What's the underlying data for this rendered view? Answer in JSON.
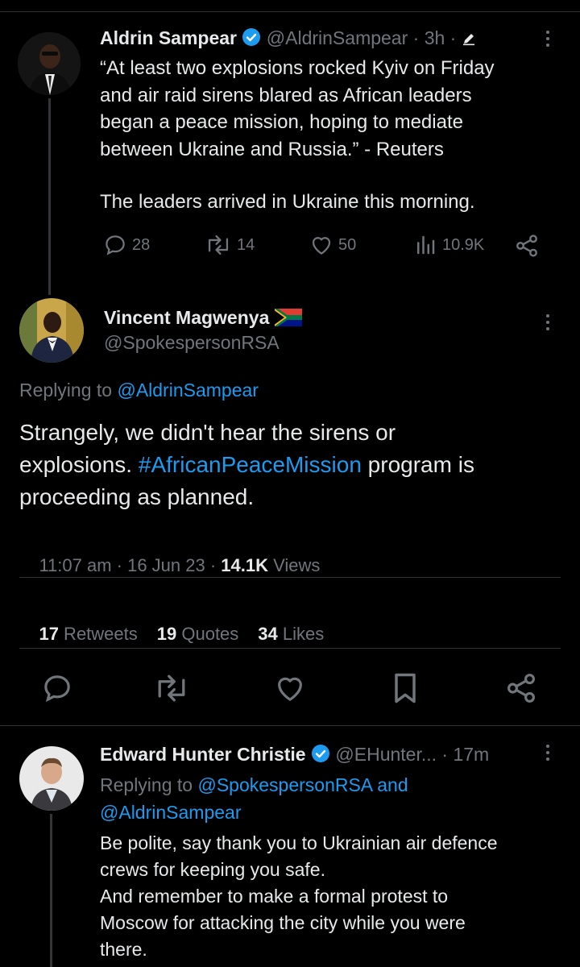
{
  "tweet1": {
    "display_name": "Aldrin Sampear",
    "handle": "@AldrinSampear",
    "time": "· 3h ·",
    "lines": [
      "“At least two explosions rocked Kyiv on Friday",
      "and air raid sirens blared as African leaders",
      "began a peace mission, hoping to mediate",
      "between Ukraine and Russia.” - Reuters"
    ],
    "line2": "The leaders arrived in Ukraine this morning.",
    "replies": "28",
    "retweets": "14",
    "likes": "50",
    "views": "10.9K"
  },
  "tweet2": {
    "display_name": "Vincent Magwenya",
    "handle": "@SpokespersonRSA",
    "replying_prefix": "Replying to",
    "replying_to": "@AldrinSampear",
    "text_1": "Strangely, we didn't hear the sirens or",
    "text_2a": "explosions. ",
    "hashtag": "#AfricanPeaceMission",
    "text_2b": " program is",
    "text_3": "proceeding as planned.",
    "timestamp": "11:07 am · 16 Jun 23 · ",
    "views_count": "14.1K",
    "views_label": " Views",
    "stats": {
      "retweets_count": "17",
      "retweets_label": " Retweets",
      "quotes_count": "19",
      "quotes_label": " Quotes",
      "likes_count": "34",
      "likes_label": " Likes"
    }
  },
  "tweet3": {
    "display_name": "Edward Hunter Christie",
    "handle": "@EHunter...",
    "time": "· 17m",
    "replying_prefix": "Replying to",
    "replying_to_1": "@SpokespersonRSA and",
    "replying_to_2": "@AldrinSampear",
    "lines": [
      "Be polite, say thank you to Ukrainian air defence",
      "crews for keeping you safe.",
      "And remember to make a formal protest to",
      "Moscow for attacking the city while you were",
      "there."
    ]
  },
  "colors": {
    "accent": "#1d9bf0",
    "muted": "#71767b",
    "text": "#e7e9ea",
    "background": "#000000"
  }
}
